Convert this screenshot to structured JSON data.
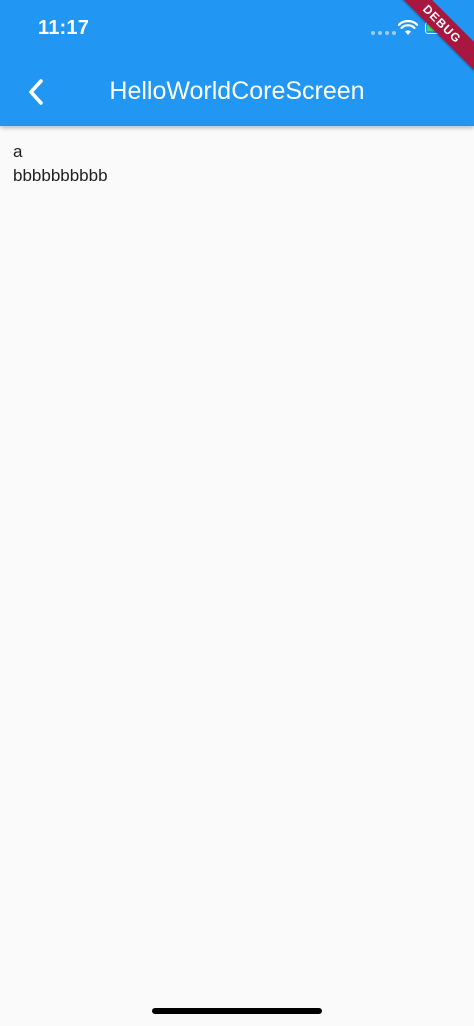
{
  "status_bar": {
    "time": "11:17"
  },
  "debug_banner": {
    "label": "DEBUG"
  },
  "app_bar": {
    "title": "HelloWorldCoreScreen",
    "back_icon": "chevron-left-icon",
    "background_color": "#2196f3"
  },
  "content": {
    "line1": "a",
    "line2": "bbbbbbbbbb"
  }
}
